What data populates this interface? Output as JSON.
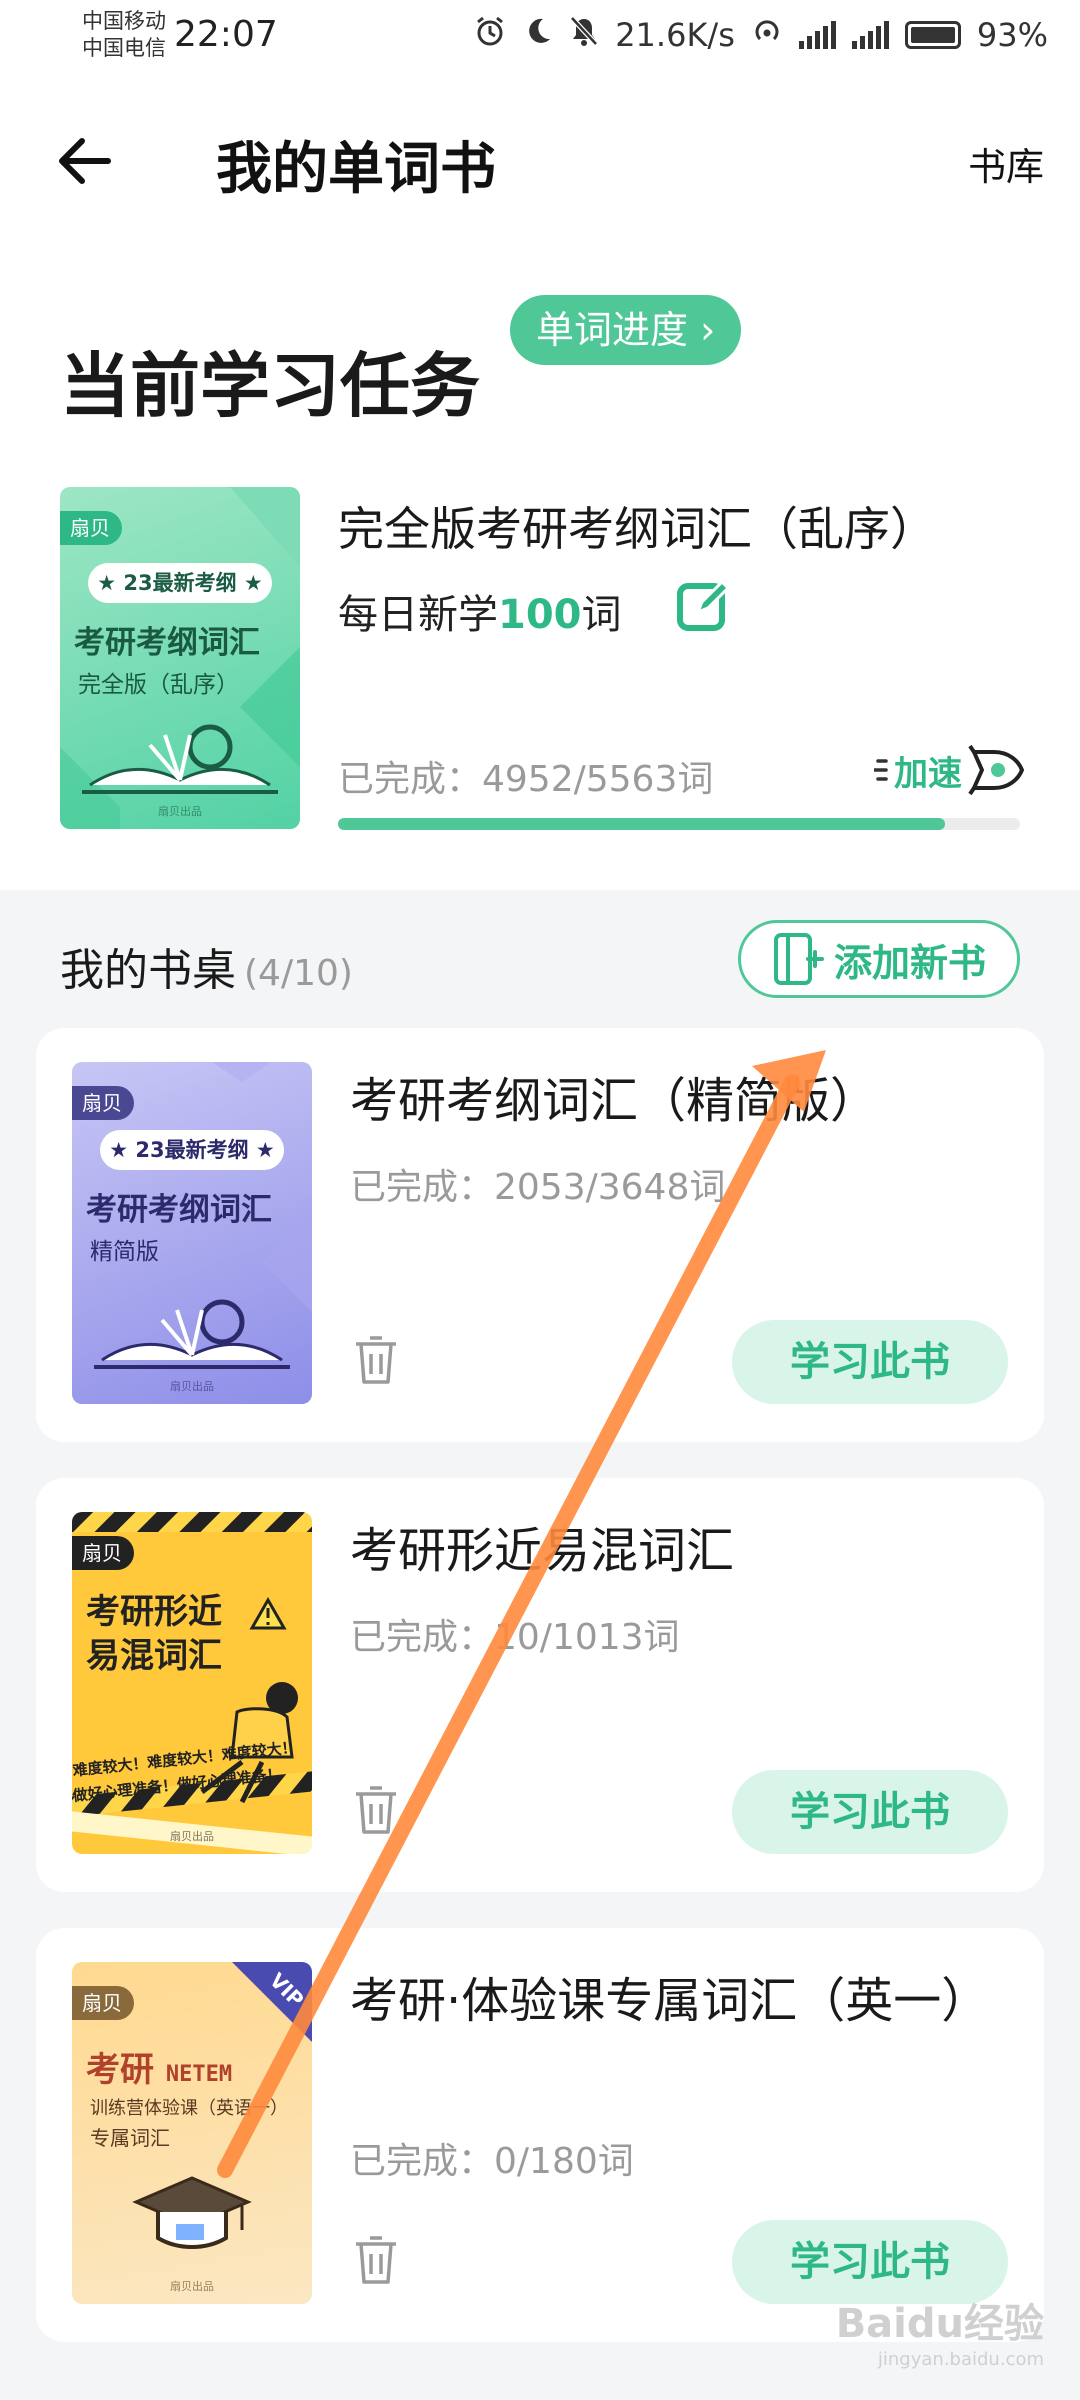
{
  "status_bar": {
    "carrier_1": "中国移动",
    "carrier_2": "中国电信",
    "time": "22:07",
    "net_speed": "21.6K/s",
    "battery": "93%"
  },
  "header": {
    "title": "我的单词书",
    "library_link": "书库"
  },
  "task": {
    "title": "当前学习任务",
    "progress_button": "单词进度 ›",
    "book_title": "完全版考研考纲词汇（乱序）",
    "daily_prefix": "每日新学",
    "daily_count": "100",
    "daily_suffix": "词",
    "completed": "已完成：4952/5563词",
    "speedup": "加速",
    "progress_fraction": 0.89,
    "cover": {
      "brand": "扇贝",
      "badge": "★ 23最新考纲 ★",
      "title": "考研考纲词汇",
      "subtitle": "完全版（乱序）",
      "publisher": "扇贝出品"
    }
  },
  "desk": {
    "title": "我的书桌",
    "count": "(4/10)",
    "add_button": "添加新书",
    "books": [
      {
        "title": "考研考纲词汇（精简版）",
        "completed": "已完成：2053/3648词",
        "study_button": "学习此书",
        "cover": {
          "brand": "扇贝",
          "badge": "★ 23最新考纲 ★",
          "title": "考研考纲词汇",
          "subtitle": "精简版",
          "publisher": "扇贝出品"
        }
      },
      {
        "title": "考研形近易混词汇",
        "completed": "已完成：10/1013词",
        "study_button": "学习此书",
        "cover": {
          "brand": "扇贝",
          "title_line_1": "考研形近",
          "title_line_2": "易混词汇",
          "tape_text": "难度较大！难度较大！难度较大！",
          "tape_text_2": "做好心理准备！做好心理准备！",
          "publisher": "扇贝出品"
        }
      },
      {
        "title": "考研·体验课专属词汇（英一）",
        "completed": "已完成：0/180词",
        "study_button": "学习此书",
        "cover": {
          "brand": "扇贝",
          "vip": "VIP",
          "title": "考研",
          "title_en": "NETEM",
          "subtitle_1": "训练营体验课（英语一）",
          "subtitle_2": "专属词汇",
          "publisher": "扇贝出品"
        }
      }
    ]
  },
  "watermark": {
    "brand": "Baidu经验",
    "url": "jingyan.baidu.com"
  },
  "colors": {
    "accent": "#4fc797",
    "accent_dark": "#2eb886",
    "annotation_arrow": "#ff8a3d"
  }
}
